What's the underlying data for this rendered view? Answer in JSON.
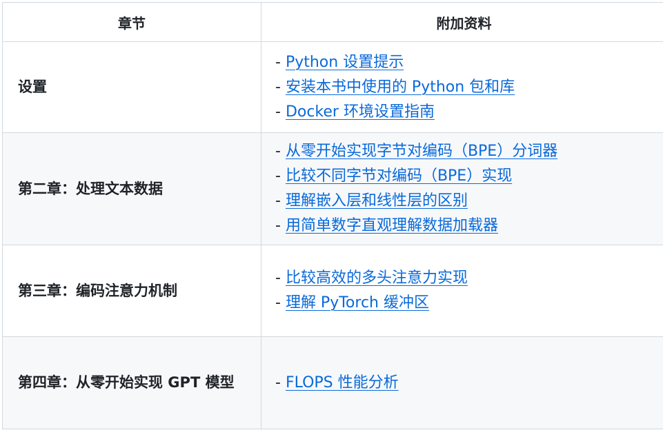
{
  "table": {
    "headers": [
      "章节",
      "附加资料"
    ],
    "rows": [
      {
        "chapter": "设置",
        "links": [
          "Python 设置提示",
          "安装本书中使用的 Python 包和库",
          "Docker 环境设置指南"
        ]
      },
      {
        "chapter": "第二章：处理文本数据",
        "links": [
          "从零开始实现字节对编码（BPE）分词器",
          "比较不同字节对编码（BPE）实现",
          "理解嵌入层和线性层的区别",
          "用简单数字直观理解数据加载器"
        ]
      },
      {
        "chapter": "第三章：编码注意力机制",
        "links": [
          "比较高效的多头注意力实现",
          "理解 PyTorch 缓冲区"
        ]
      },
      {
        "chapter": "第四章：从零开始实现 GPT 模型",
        "links": [
          "FLOPS 性能分析"
        ]
      }
    ]
  },
  "bullet_prefix": "- ",
  "colors": {
    "link": "#0969da",
    "text": "#1f2328",
    "border": "#d1d9e0",
    "alt_row_bg": "#f6f8fa"
  }
}
